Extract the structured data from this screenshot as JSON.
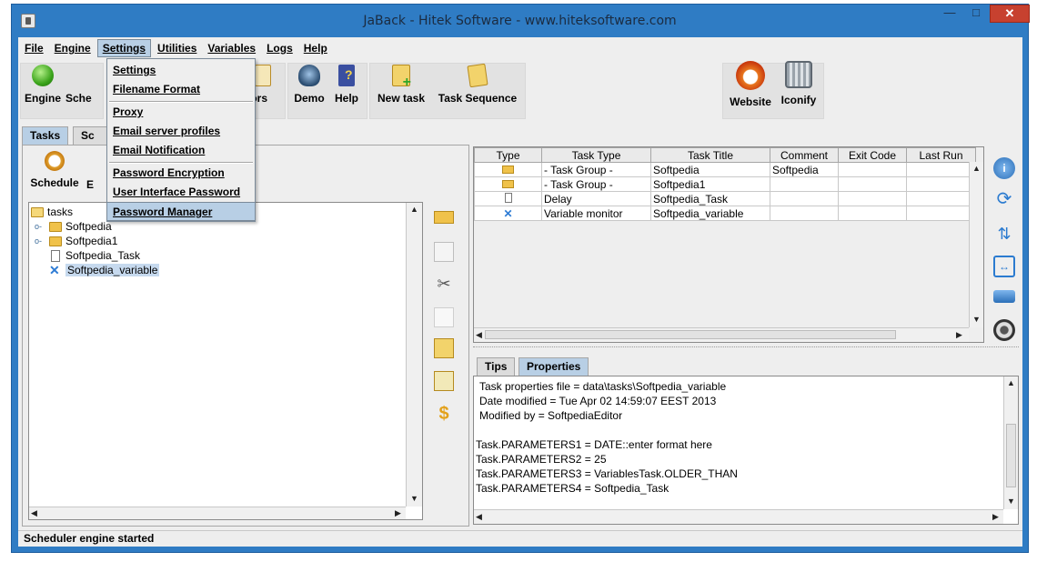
{
  "window": {
    "title": "JaBack     - Hitek Software - www.hitek​software.com",
    "controls": {
      "minimize": "—",
      "maximize": "□",
      "close": "✕"
    }
  },
  "menubar": {
    "items": [
      "File",
      "Engine",
      "Settings",
      "Utilities",
      "Variables",
      "Logs",
      "Help"
    ],
    "active": "Settings"
  },
  "settings_menu": {
    "items": [
      "Settings",
      "Filename Format",
      "Proxy",
      "Email server profiles",
      "Email Notification",
      "Password Encryption",
      "User Interface Password",
      "Password Manager"
    ],
    "highlighted": "Password Manager"
  },
  "toolbar": {
    "engine": "Engine",
    "schedule_partial": "Sche",
    "errors_partial": "rrors",
    "demo": "Demo",
    "help": "Help",
    "new_task": "New task",
    "task_sequence": "Task Sequence",
    "website": "Website",
    "iconify": "Iconify"
  },
  "tabs": {
    "tasks": "Tasks",
    "second_partial": "Sc"
  },
  "left_tools": {
    "schedule": "Schedule",
    "partial": "E"
  },
  "tree": {
    "root": "tasks",
    "children": [
      {
        "label": "Softpedia",
        "kind": "folder",
        "expandable": true
      },
      {
        "label": "Softpedia1",
        "kind": "folder",
        "expandable": true
      },
      {
        "label": "Softpedia_Task",
        "kind": "doc",
        "expandable": false
      },
      {
        "label": "Softpedia_variable",
        "kind": "variable",
        "expandable": false,
        "selected": true
      }
    ]
  },
  "task_table": {
    "columns": [
      "Type",
      "Task Type",
      "Task Title",
      "Comment",
      "Exit Code",
      "Last Run"
    ],
    "rows": [
      {
        "type_icon": "folder-icon",
        "task_type": "- Task Group -",
        "task_title": "Softpedia",
        "comment": "Softpedia",
        "exit_code": "",
        "last_run": ""
      },
      {
        "type_icon": "folder-icon",
        "task_type": "- Task Group -",
        "task_title": "Softpedia1",
        "comment": "",
        "exit_code": "",
        "last_run": ""
      },
      {
        "type_icon": "document-icon",
        "task_type": "Delay",
        "task_title": "Softpedia_Task",
        "comment": "",
        "exit_code": "",
        "last_run": ""
      },
      {
        "type_icon": "variable-icon",
        "task_type": "Variable monitor",
        "task_title": "Softpedia_variable",
        "comment": "",
        "exit_code": "",
        "last_run": ""
      }
    ]
  },
  "props_tabs": {
    "tips": "Tips",
    "properties": "Properties",
    "active": "Properties"
  },
  "properties_text": [
    "Task properties file = data\\tasks\\Softpedia_variable",
    "Date modified = Tue Apr 02 14:59:07 EEST 2013",
    "Modified by = SoftpediaEditor",
    "",
    "Task.PARAMETERS1 = DATE::enter format here",
    "Task.PARAMETERS2 = 25",
    "Task.PARAMETERS3 = VariablesTask.OLDER_THAN",
    "Task.PARAMETERS4 = Softpedia_Task"
  ],
  "status": "Scheduler engine started",
  "colors": {
    "frame": "#2f7cc4",
    "close_button": "#c7412f",
    "menu_highlight": "#b8cfe5",
    "tree_selection": "#c6d9ee",
    "panel": "#eeeeee"
  }
}
